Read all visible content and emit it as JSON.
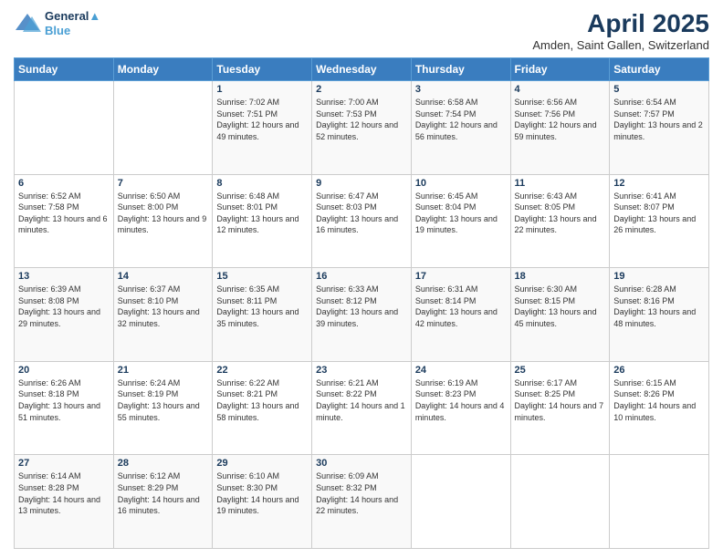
{
  "logo": {
    "line1": "General",
    "line2": "Blue"
  },
  "title": "April 2025",
  "subtitle": "Amden, Saint Gallen, Switzerland",
  "days_header": [
    "Sunday",
    "Monday",
    "Tuesday",
    "Wednesday",
    "Thursday",
    "Friday",
    "Saturday"
  ],
  "weeks": [
    [
      {
        "day": "",
        "info": ""
      },
      {
        "day": "",
        "info": ""
      },
      {
        "day": "1",
        "info": "Sunrise: 7:02 AM\nSunset: 7:51 PM\nDaylight: 12 hours and 49 minutes."
      },
      {
        "day": "2",
        "info": "Sunrise: 7:00 AM\nSunset: 7:53 PM\nDaylight: 12 hours and 52 minutes."
      },
      {
        "day": "3",
        "info": "Sunrise: 6:58 AM\nSunset: 7:54 PM\nDaylight: 12 hours and 56 minutes."
      },
      {
        "day": "4",
        "info": "Sunrise: 6:56 AM\nSunset: 7:56 PM\nDaylight: 12 hours and 59 minutes."
      },
      {
        "day": "5",
        "info": "Sunrise: 6:54 AM\nSunset: 7:57 PM\nDaylight: 13 hours and 2 minutes."
      }
    ],
    [
      {
        "day": "6",
        "info": "Sunrise: 6:52 AM\nSunset: 7:58 PM\nDaylight: 13 hours and 6 minutes."
      },
      {
        "day": "7",
        "info": "Sunrise: 6:50 AM\nSunset: 8:00 PM\nDaylight: 13 hours and 9 minutes."
      },
      {
        "day": "8",
        "info": "Sunrise: 6:48 AM\nSunset: 8:01 PM\nDaylight: 13 hours and 12 minutes."
      },
      {
        "day": "9",
        "info": "Sunrise: 6:47 AM\nSunset: 8:03 PM\nDaylight: 13 hours and 16 minutes."
      },
      {
        "day": "10",
        "info": "Sunrise: 6:45 AM\nSunset: 8:04 PM\nDaylight: 13 hours and 19 minutes."
      },
      {
        "day": "11",
        "info": "Sunrise: 6:43 AM\nSunset: 8:05 PM\nDaylight: 13 hours and 22 minutes."
      },
      {
        "day": "12",
        "info": "Sunrise: 6:41 AM\nSunset: 8:07 PM\nDaylight: 13 hours and 26 minutes."
      }
    ],
    [
      {
        "day": "13",
        "info": "Sunrise: 6:39 AM\nSunset: 8:08 PM\nDaylight: 13 hours and 29 minutes."
      },
      {
        "day": "14",
        "info": "Sunrise: 6:37 AM\nSunset: 8:10 PM\nDaylight: 13 hours and 32 minutes."
      },
      {
        "day": "15",
        "info": "Sunrise: 6:35 AM\nSunset: 8:11 PM\nDaylight: 13 hours and 35 minutes."
      },
      {
        "day": "16",
        "info": "Sunrise: 6:33 AM\nSunset: 8:12 PM\nDaylight: 13 hours and 39 minutes."
      },
      {
        "day": "17",
        "info": "Sunrise: 6:31 AM\nSunset: 8:14 PM\nDaylight: 13 hours and 42 minutes."
      },
      {
        "day": "18",
        "info": "Sunrise: 6:30 AM\nSunset: 8:15 PM\nDaylight: 13 hours and 45 minutes."
      },
      {
        "day": "19",
        "info": "Sunrise: 6:28 AM\nSunset: 8:16 PM\nDaylight: 13 hours and 48 minutes."
      }
    ],
    [
      {
        "day": "20",
        "info": "Sunrise: 6:26 AM\nSunset: 8:18 PM\nDaylight: 13 hours and 51 minutes."
      },
      {
        "day": "21",
        "info": "Sunrise: 6:24 AM\nSunset: 8:19 PM\nDaylight: 13 hours and 55 minutes."
      },
      {
        "day": "22",
        "info": "Sunrise: 6:22 AM\nSunset: 8:21 PM\nDaylight: 13 hours and 58 minutes."
      },
      {
        "day": "23",
        "info": "Sunrise: 6:21 AM\nSunset: 8:22 PM\nDaylight: 14 hours and 1 minute."
      },
      {
        "day": "24",
        "info": "Sunrise: 6:19 AM\nSunset: 8:23 PM\nDaylight: 14 hours and 4 minutes."
      },
      {
        "day": "25",
        "info": "Sunrise: 6:17 AM\nSunset: 8:25 PM\nDaylight: 14 hours and 7 minutes."
      },
      {
        "day": "26",
        "info": "Sunrise: 6:15 AM\nSunset: 8:26 PM\nDaylight: 14 hours and 10 minutes."
      }
    ],
    [
      {
        "day": "27",
        "info": "Sunrise: 6:14 AM\nSunset: 8:28 PM\nDaylight: 14 hours and 13 minutes."
      },
      {
        "day": "28",
        "info": "Sunrise: 6:12 AM\nSunset: 8:29 PM\nDaylight: 14 hours and 16 minutes."
      },
      {
        "day": "29",
        "info": "Sunrise: 6:10 AM\nSunset: 8:30 PM\nDaylight: 14 hours and 19 minutes."
      },
      {
        "day": "30",
        "info": "Sunrise: 6:09 AM\nSunset: 8:32 PM\nDaylight: 14 hours and 22 minutes."
      },
      {
        "day": "",
        "info": ""
      },
      {
        "day": "",
        "info": ""
      },
      {
        "day": "",
        "info": ""
      }
    ]
  ]
}
